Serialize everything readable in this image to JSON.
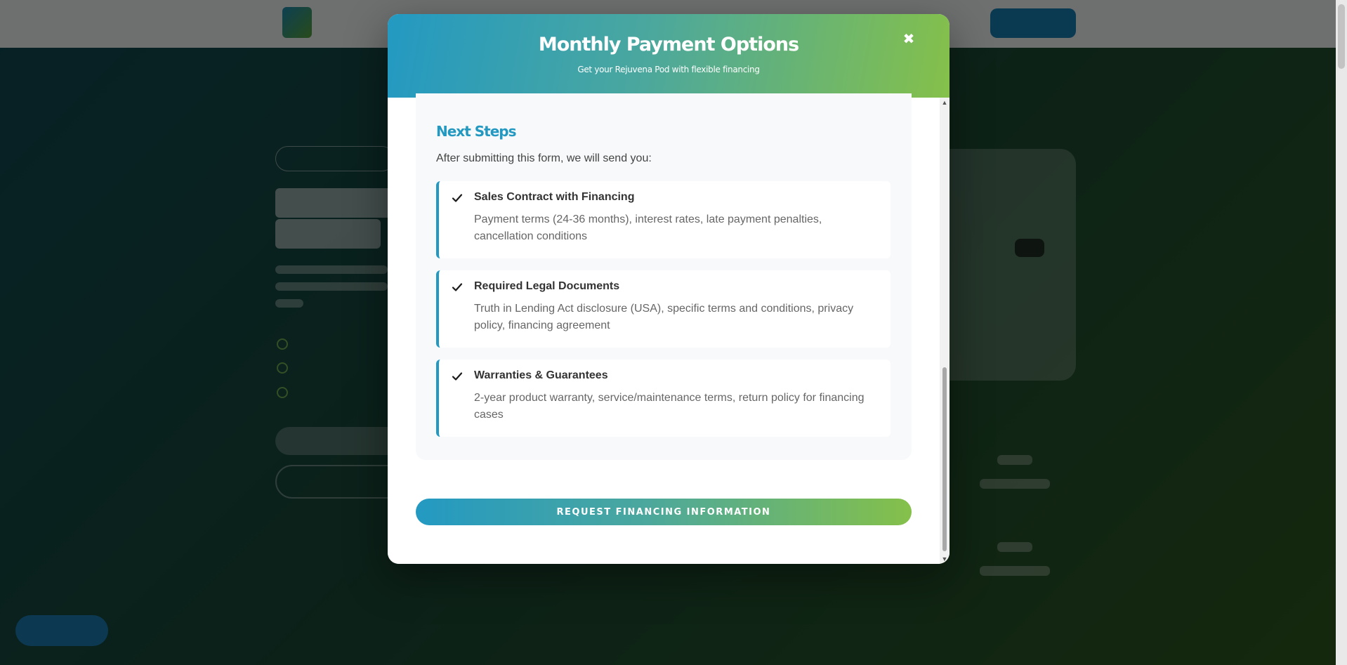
{
  "modal": {
    "title": "Monthly Payment Options",
    "subtitle": "Get your Rejuvena Pod with flexible financing",
    "close_icon": "close-icon"
  },
  "next_steps": {
    "title": "Next Steps",
    "description": "After submitting this form, we will send you:",
    "items": [
      {
        "title": "Sales Contract with Financing",
        "description": "Payment terms (24-36 months), interest rates, late payment penalties, cancellation conditions",
        "icon": "check-icon"
      },
      {
        "title": "Required Legal Documents",
        "description": "Truth in Lending Act disclosure (USA), specific terms and conditions, privacy policy, financing agreement",
        "icon": "check-icon"
      },
      {
        "title": "Warranties & Guarantees",
        "description": "2-year product warranty, service/maintenance terms, return policy for financing cases",
        "icon": "check-icon"
      }
    ]
  },
  "actions": {
    "request_label": "REQUEST FINANCING INFORMATION"
  },
  "colors": {
    "accent_blue": "#2399c2",
    "accent_green": "#85c04a"
  }
}
